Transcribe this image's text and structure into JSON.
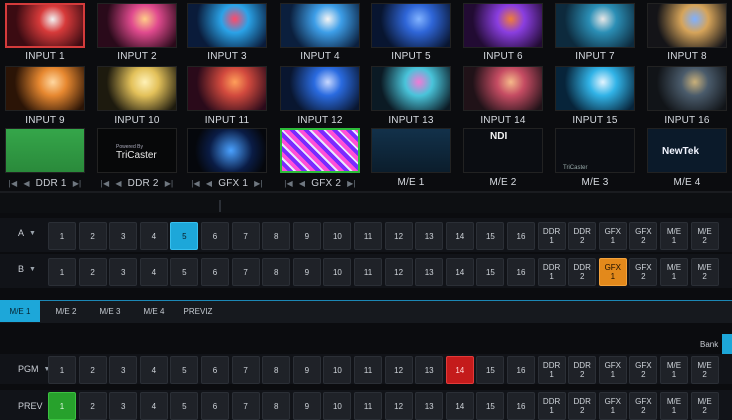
{
  "inputs": [
    "INPUT 1",
    "INPUT 2",
    "INPUT 3",
    "INPUT 4",
    "INPUT 5",
    "INPUT 6",
    "INPUT 7",
    "INPUT 8",
    "INPUT 9",
    "INPUT 10",
    "INPUT 11",
    "INPUT 12",
    "INPUT 13",
    "INPUT 14",
    "INPUT 15",
    "INPUT 16"
  ],
  "sources_row3": [
    "DDR 1",
    "DDR 2",
    "GFX 1",
    "GFX 2",
    "M/E 1",
    "M/E 2",
    "M/E 3",
    "M/E 4"
  ],
  "tile_texts": {
    "tricaster_small": "Powered By",
    "tricaster": "TriCaster",
    "ndi": "NDI",
    "tricaster_me3": "TriCaster",
    "newtek": "NewTek"
  },
  "row_a": {
    "label": "A",
    "selected": "5"
  },
  "row_b": {
    "label": "B",
    "selected": "GFX 1"
  },
  "buttons_numeric": [
    "1",
    "2",
    "3",
    "4",
    "5",
    "6",
    "7",
    "8",
    "9",
    "10",
    "11",
    "12",
    "13",
    "14",
    "15",
    "16"
  ],
  "buttons_named": [
    [
      "DDR",
      "1"
    ],
    [
      "DDR",
      "2"
    ],
    [
      "GFX",
      "1"
    ],
    [
      "GFX",
      "2"
    ],
    [
      "M/E",
      "1"
    ],
    [
      "M/E",
      "2"
    ]
  ],
  "tabs": [
    "M/E 1",
    "M/E 2",
    "M/E 3",
    "M/E 4",
    "PREVIZ"
  ],
  "active_tab": "M/E 1",
  "bank_label": "Bank",
  "row_pgm": {
    "label": "PGM",
    "selected": "14"
  },
  "row_prev": {
    "label": "PREV",
    "selected": "1"
  },
  "colors": {
    "accent_blue": "#1da7d9",
    "tally_red": "#c41b1b",
    "tally_green": "#27a12c",
    "preview_orange": "#e3891b"
  }
}
